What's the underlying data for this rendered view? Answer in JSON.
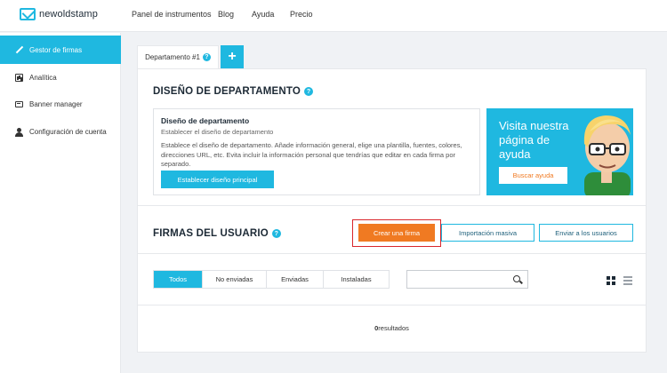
{
  "brand": {
    "name": "newoldstamp"
  },
  "topnav": [
    "Panel de instrumentos",
    "Blog",
    "Ayuda",
    "Precio"
  ],
  "sidebar": {
    "items": [
      {
        "label": "Gestor de firmas",
        "active": true,
        "icon": "pen-icon"
      },
      {
        "label": "Analítica",
        "active": false,
        "icon": "chart-icon"
      },
      {
        "label": "Banner manager",
        "active": false,
        "icon": "banner-icon"
      },
      {
        "label": "Configuración de cuenta",
        "active": false,
        "icon": "user-icon"
      }
    ]
  },
  "tabs": {
    "department_tab": "Departamento #1",
    "help_badge": "?",
    "add": "+"
  },
  "department": {
    "title": "DISEÑO DE DEPARTAMENTO",
    "box_title": "Diseño de departamento",
    "box_subtitle": "Establecer el diseño de departamento",
    "box_description": "Establece el diseño de departamento. Añade información general, elige una plantilla, fuentes, colores, direcciones URL, etc. Evita incluir la información personal que tendrías que editar en cada firma por separado.",
    "main_button": "Establecer diseño principal"
  },
  "promo": {
    "text": "Visita nuestra página de ayuda",
    "button": "Buscar ayuda"
  },
  "signatures": {
    "title": "FIRMAS DEL USUARIO",
    "create_button": "Crear una firma",
    "import_button": "Importación masiva",
    "send_button": "Enviar a los usuarios",
    "filters": [
      "Todos",
      "No enviadas",
      "Enviadas",
      "Instaladas"
    ],
    "active_filter": "Todos",
    "search_placeholder": "",
    "results_count": "0",
    "results_label": "resultados"
  },
  "colors": {
    "accent": "#1fb8e0",
    "orange": "#f07a22",
    "highlight": "#d9262c"
  }
}
